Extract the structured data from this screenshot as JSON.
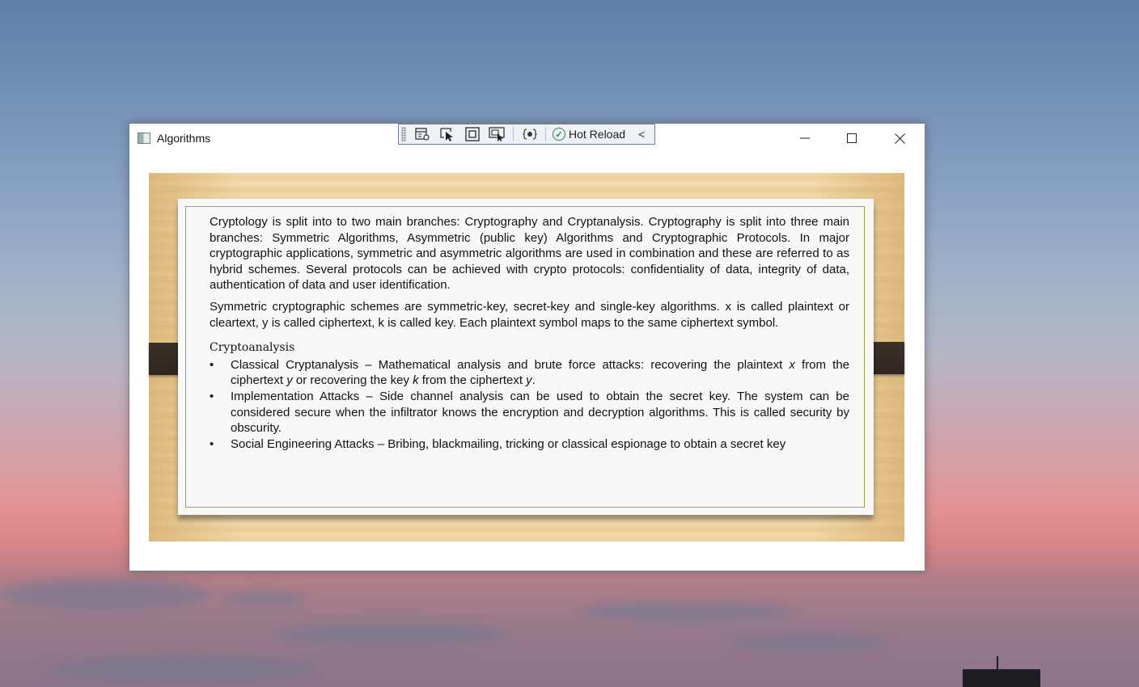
{
  "window": {
    "title": "Algorithms",
    "controls": {
      "minimize": "—",
      "maximize": "☐",
      "close": "✕"
    }
  },
  "toolbar": {
    "hot_reload_label": "Hot Reload",
    "check_glyph": "✓",
    "collapse_glyph": "<",
    "icons": [
      "live-visual-tree-icon",
      "select-element-icon",
      "display-layout-adorners-icon",
      "track-focused-element-icon",
      "binding-failures-icon"
    ]
  },
  "document": {
    "paragraph1": "Cryptology is split into to two main branches: Cryptography and Cryptanalysis.   Cryptography is split into three main branches: Symmetric Algorithms, Asymmetric (public key) Algorithms and Cryptographic Protocols. In major cryptographic applications, symmetric and asymmetric algorithms are used in combination and these are referred to as hybrid schemes.   Several protocols can be achieved with crypto protocols: confidentiality of data, integrity of data, authentication of data and user identification.",
    "paragraph2": "Symmetric cryptographic schemes are symmetric-key, secret-key and single-key algorithms. x is called plaintext or cleartext, y is called ciphertext, k is called key.    Each plaintext symbol maps to the same ciphertext symbol.",
    "section_title": "Cryptoanalysis",
    "bullets": {
      "b1_a": "Classical Cryptanalysis – Mathematical analysis and brute force attacks: recovering the plaintext ",
      "b1_x": "x",
      "b1_b": " from the ciphertext ",
      "b1_y": "y",
      "b1_c": " or recovering the key ",
      "b1_k": "k",
      "b1_d": " from the ciphertext ",
      "b1_y2": "y",
      "b1_e": ".",
      "b2": "Implementation Attacks – Side channel analysis can be used to obtain the secret key. The system can be considered secure when the infiltrator knows the encryption and decryption algorithms. This is called security by obscurity.",
      "b3": "Social Engineering Attacks – Bribing, blackmailing, tricking or classical espionage to obtain a secret key"
    }
  },
  "colors": {
    "paper_border": "#8faa47",
    "toolbar_border": "#6a7ea9",
    "check_green": "#2a8a3a"
  }
}
